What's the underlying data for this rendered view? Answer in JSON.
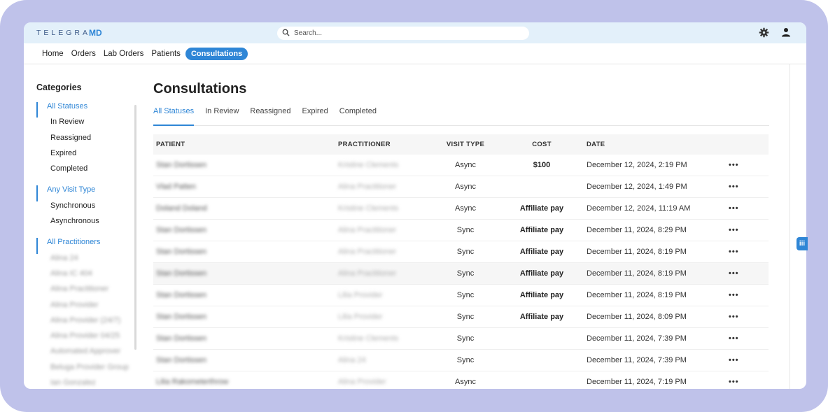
{
  "app": {
    "logo_text": "TELEGRA",
    "logo_mark": "MD"
  },
  "search": {
    "placeholder": "Search..."
  },
  "icons": {
    "search": "search-icon",
    "settings": "gear-icon",
    "account": "user-icon",
    "feedback": "feedback-icon"
  },
  "colors": {
    "accent": "#2f86d6",
    "topbar": "#e3f0fa",
    "frame": "#bfc2ea"
  },
  "nav": {
    "items": [
      "Home",
      "Orders",
      "Lab Orders",
      "Patients",
      "Consultations"
    ],
    "active": "Consultations"
  },
  "sidebar": {
    "title": "Categories",
    "statuses": {
      "head": "All Statuses",
      "items": [
        "In Review",
        "Reassigned",
        "Expired",
        "Completed"
      ]
    },
    "visit_types": {
      "head": "Any Visit Type",
      "items": [
        "Synchronous",
        "Asynchronous"
      ]
    },
    "practitioners": {
      "head": "All Practitioners",
      "items": [
        "Alina 24",
        "Alina IC 404",
        "Alina Practitioner",
        "Alina Provider",
        "Alina Provider (24/7)",
        "Alina Provider 04/25",
        "Automated Approver",
        "Beluga Provider Group",
        "Ian Gonzalez"
      ]
    }
  },
  "main": {
    "title": "Consultations",
    "tabs": [
      "All Statuses",
      "In Review",
      "Reassigned",
      "Expired",
      "Completed"
    ],
    "active_tab": "All Statuses",
    "columns": [
      "PATIENT",
      "PRACTITIONER",
      "VISIT TYPE",
      "COST",
      "DATE"
    ],
    "more_label": "•••",
    "rows": [
      {
        "patient": "Stan Dortissen",
        "practitioner": "Kristine Clements",
        "visit_type": "Async",
        "cost": "$100",
        "date": "December 12, 2024, 2:19 PM"
      },
      {
        "patient": "Vlad Patten",
        "practitioner": "Alina Practitioner",
        "visit_type": "Async",
        "cost": "",
        "date": "December 12, 2024, 1:49 PM"
      },
      {
        "patient": "Doland Doland",
        "practitioner": "Kristine Clements",
        "visit_type": "Async",
        "cost": "Affiliate pay",
        "date": "December 12, 2024, 11:19 AM"
      },
      {
        "patient": "Stan Dortissen",
        "practitioner": "Alina Practitioner",
        "visit_type": "Sync",
        "cost": "Affiliate pay",
        "date": "December 11, 2024, 8:29 PM"
      },
      {
        "patient": "Stan Dortissen",
        "practitioner": "Alina Practitioner",
        "visit_type": "Sync",
        "cost": "Affiliate pay",
        "date": "December 11, 2024, 8:19 PM"
      },
      {
        "patient": "Stan Dortissen",
        "practitioner": "Alina Practitioner",
        "visit_type": "Sync",
        "cost": "Affiliate pay",
        "date": "December 11, 2024, 8:19 PM"
      },
      {
        "patient": "Stan Dortissen",
        "practitioner": "Lilia Provider",
        "visit_type": "Sync",
        "cost": "Affiliate pay",
        "date": "December 11, 2024, 8:19 PM"
      },
      {
        "patient": "Stan Dortissen",
        "practitioner": "Lilia Provider",
        "visit_type": "Sync",
        "cost": "Affiliate pay",
        "date": "December 11, 2024, 8:09 PM"
      },
      {
        "patient": "Stan Dortissen",
        "practitioner": "Kristine Clements",
        "visit_type": "Sync",
        "cost": "",
        "date": "December 11, 2024, 7:39 PM"
      },
      {
        "patient": "Stan Dortissen",
        "practitioner": "Alina 24",
        "visit_type": "Sync",
        "cost": "",
        "date": "December 11, 2024, 7:39 PM"
      },
      {
        "patient": "Lilia Rakometerthrow",
        "practitioner": "Alina Provider",
        "visit_type": "Async",
        "cost": "",
        "date": "December 11, 2024, 7:19 PM"
      }
    ]
  }
}
